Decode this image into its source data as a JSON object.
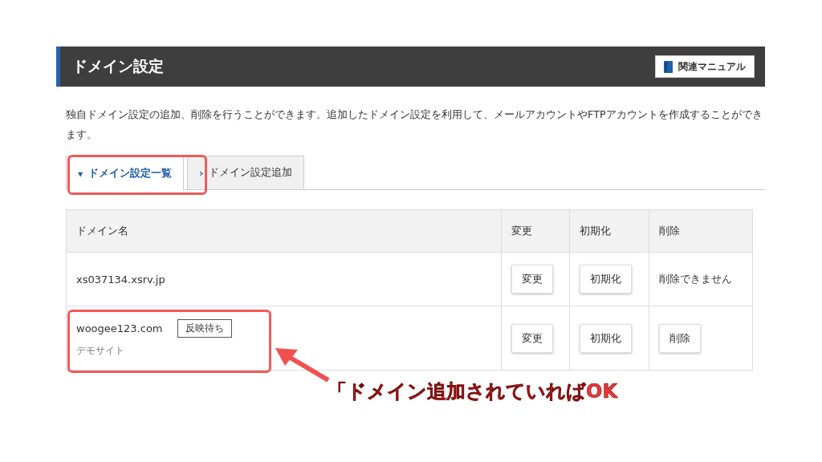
{
  "header": {
    "title": "ドメイン設定",
    "manual_button": "関連マニュアル"
  },
  "description": "独自ドメイン設定の追加、削除を行うことができます。追加したドメイン設定を利用して、メールアカウントやFTPアカウントを作成することができます。",
  "tabs": [
    {
      "icon": "▾",
      "label": "ドメイン設定一覧",
      "selected": true
    },
    {
      "icon": "›",
      "label": "ドメイン設定追加",
      "selected": false
    }
  ],
  "table": {
    "columns": [
      "ドメイン名",
      "変更",
      "初期化",
      "削除"
    ],
    "rows": [
      {
        "domain": "xs037134.xsrv.jp",
        "change": "変更",
        "reset": "初期化",
        "delete": {
          "kind": "text",
          "label": "削除できません"
        }
      },
      {
        "domain": "woogee123.com",
        "badge": "反映待ち",
        "note": "デモサイト",
        "change": "変更",
        "reset": "初期化",
        "delete": {
          "kind": "button",
          "label": "削除"
        }
      }
    ]
  },
  "annotation": {
    "caption": "「ドメイン追加されていればOK"
  }
}
